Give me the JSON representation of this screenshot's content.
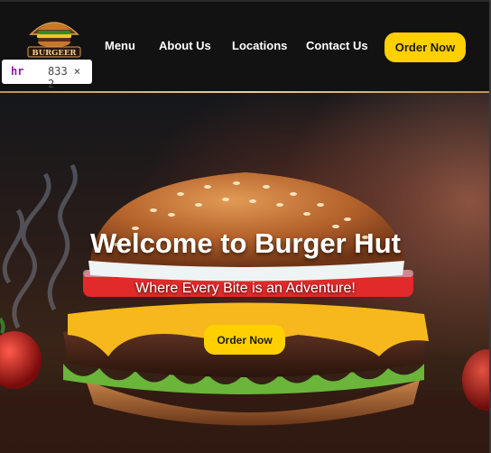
{
  "brand": {
    "logo_text": "BURGEER"
  },
  "nav": {
    "links": [
      "Menu",
      "About Us",
      "Locations",
      "Contact Us"
    ],
    "order_label": "Order Now"
  },
  "devtools_tooltip": {
    "tag": "hr",
    "size": "833 × 2"
  },
  "hero": {
    "title": "Welcome to Burger Hut",
    "subtitle": "Where Every Bite is an Adventure!",
    "order_label": "Order Now"
  },
  "colors": {
    "accent": "#ffd000",
    "navbar_bg": "#121212",
    "rule": "#d9bd84"
  }
}
